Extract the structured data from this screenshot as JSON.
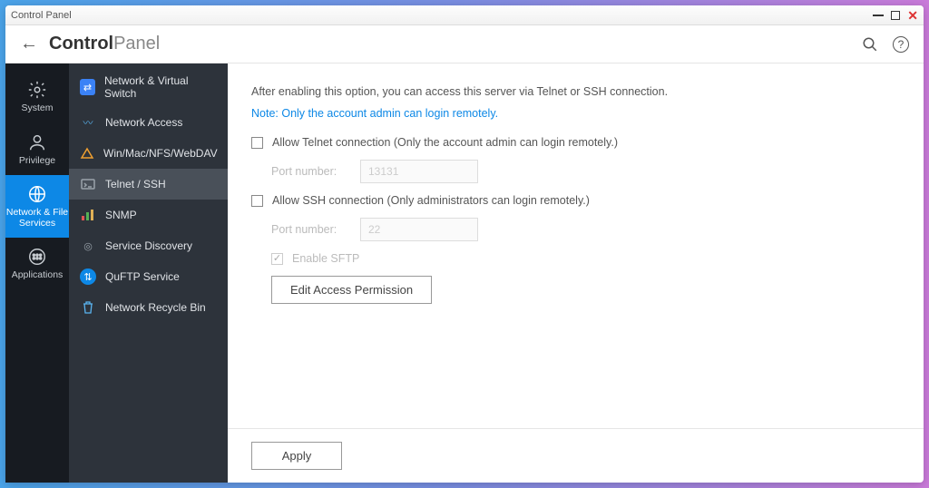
{
  "window": {
    "title": "Control Panel"
  },
  "header": {
    "title_bold": "Control",
    "title_light": "Panel"
  },
  "rail": {
    "items": [
      {
        "label": "System"
      },
      {
        "label": "Privilege"
      },
      {
        "label": "Network & File Services"
      },
      {
        "label": "Applications"
      }
    ]
  },
  "subnav": {
    "items": [
      {
        "label": "Network & Virtual Switch"
      },
      {
        "label": "Network Access"
      },
      {
        "label": "Win/Mac/NFS/WebDAV"
      },
      {
        "label": "Telnet / SSH"
      },
      {
        "label": "SNMP"
      },
      {
        "label": "Service Discovery"
      },
      {
        "label": "QuFTP Service"
      },
      {
        "label": "Network Recycle Bin"
      }
    ]
  },
  "main": {
    "description": "After enabling this option, you can access this server via Telnet or SSH connection.",
    "note": "Note: Only the account admin can login remotely.",
    "telnet": {
      "label": "Allow Telnet connection (Only the account admin can login remotely.)",
      "port_label": "Port number:",
      "port_placeholder": "13131"
    },
    "ssh": {
      "label": "Allow SSH connection (Only administrators can login remotely.)",
      "port_label": "Port number:",
      "port_placeholder": "22",
      "sftp_label": "Enable SFTP"
    },
    "edit_button": "Edit Access Permission",
    "apply_button": "Apply"
  }
}
